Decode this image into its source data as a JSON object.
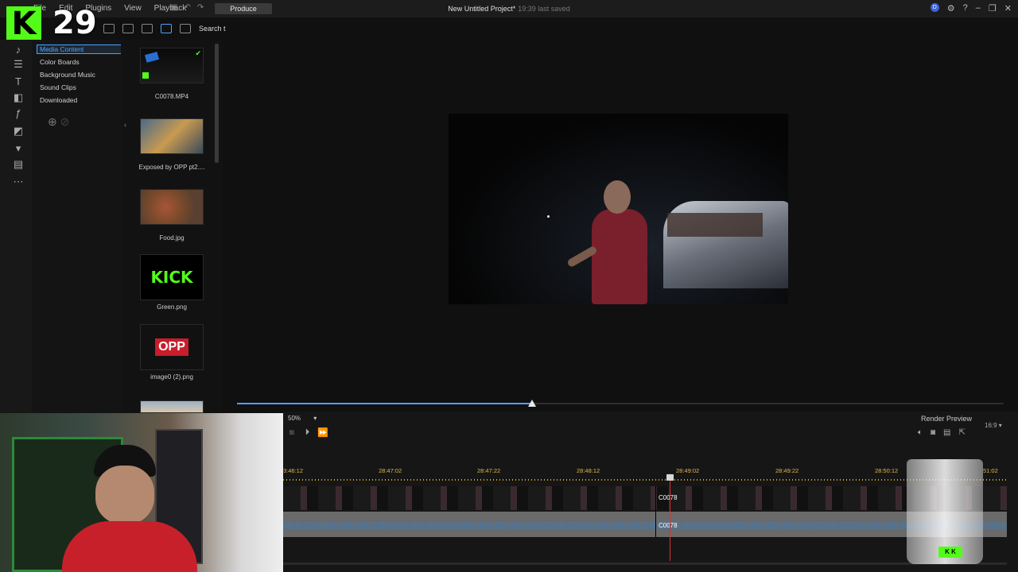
{
  "menu": {
    "items": [
      "File",
      "Edit",
      "Plugins",
      "View",
      "Playback"
    ],
    "produce_label": "Produce"
  },
  "window": {
    "project_title": "New Untitled Project*",
    "saved_status": "19:39 last saved",
    "account_initial": "D"
  },
  "overlay": {
    "kick_letter": "K",
    "count": "29",
    "glass_logo": "K K"
  },
  "library": {
    "search_label": "Search t",
    "categories": [
      "Media Content",
      "Color Boards",
      "Background Music",
      "Sound Clips",
      "Downloaded"
    ],
    "selected_category": "Media Content",
    "media": [
      {
        "name": "C0078.MP4",
        "checked": true
      },
      {
        "name": "Exposed by OPP pt2...."
      },
      {
        "name": "Food.jpg"
      },
      {
        "name": "Green.png"
      },
      {
        "name": "image0 (2).png"
      }
    ],
    "kick_thumb_text": "KICK",
    "opp_thumb_text": "OPP"
  },
  "preview": {
    "progress": 0.385
  },
  "timeline": {
    "zoom": "50%",
    "render_preview": "Render Preview",
    "aspect_ratio": "16:9",
    "ruler_ticks": [
      "3:46:12",
      "28:47:02",
      "28:47:22",
      "28:48:12",
      "28:49:02",
      "28:49:22",
      "28:50:12",
      "51:02"
    ],
    "clip_video": "C0078",
    "clip_audio": "C0078"
  },
  "colors": {
    "accent": "#4aa3ff",
    "kick_green": "#53fc18",
    "playhead": "#dd3333",
    "ruler": "#e0b84a"
  }
}
